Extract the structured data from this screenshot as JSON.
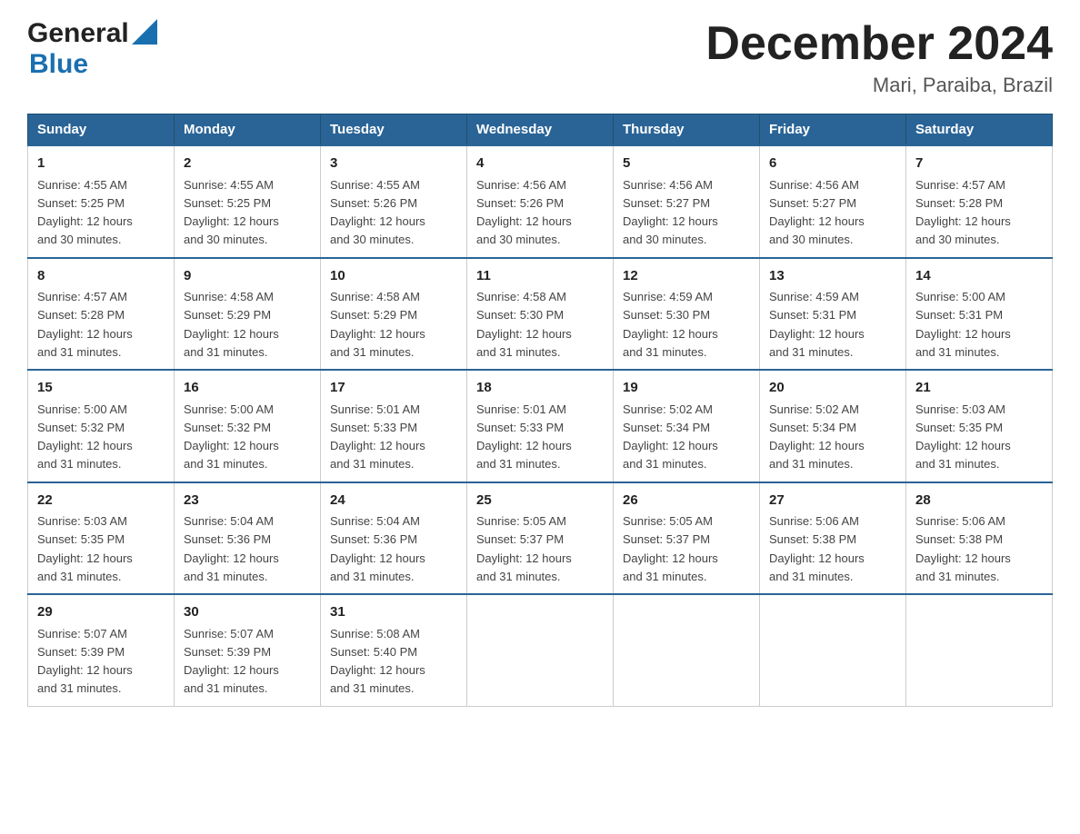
{
  "header": {
    "logo_general": "General",
    "logo_blue": "Blue",
    "title": "December 2024",
    "subtitle": "Mari, Paraiba, Brazil"
  },
  "columns": [
    "Sunday",
    "Monday",
    "Tuesday",
    "Wednesday",
    "Thursday",
    "Friday",
    "Saturday"
  ],
  "weeks": [
    [
      {
        "day": "1",
        "info": "Sunrise: 4:55 AM\nSunset: 5:25 PM\nDaylight: 12 hours\nand 30 minutes."
      },
      {
        "day": "2",
        "info": "Sunrise: 4:55 AM\nSunset: 5:25 PM\nDaylight: 12 hours\nand 30 minutes."
      },
      {
        "day": "3",
        "info": "Sunrise: 4:55 AM\nSunset: 5:26 PM\nDaylight: 12 hours\nand 30 minutes."
      },
      {
        "day": "4",
        "info": "Sunrise: 4:56 AM\nSunset: 5:26 PM\nDaylight: 12 hours\nand 30 minutes."
      },
      {
        "day": "5",
        "info": "Sunrise: 4:56 AM\nSunset: 5:27 PM\nDaylight: 12 hours\nand 30 minutes."
      },
      {
        "day": "6",
        "info": "Sunrise: 4:56 AM\nSunset: 5:27 PM\nDaylight: 12 hours\nand 30 minutes."
      },
      {
        "day": "7",
        "info": "Sunrise: 4:57 AM\nSunset: 5:28 PM\nDaylight: 12 hours\nand 30 minutes."
      }
    ],
    [
      {
        "day": "8",
        "info": "Sunrise: 4:57 AM\nSunset: 5:28 PM\nDaylight: 12 hours\nand 31 minutes."
      },
      {
        "day": "9",
        "info": "Sunrise: 4:58 AM\nSunset: 5:29 PM\nDaylight: 12 hours\nand 31 minutes."
      },
      {
        "day": "10",
        "info": "Sunrise: 4:58 AM\nSunset: 5:29 PM\nDaylight: 12 hours\nand 31 minutes."
      },
      {
        "day": "11",
        "info": "Sunrise: 4:58 AM\nSunset: 5:30 PM\nDaylight: 12 hours\nand 31 minutes."
      },
      {
        "day": "12",
        "info": "Sunrise: 4:59 AM\nSunset: 5:30 PM\nDaylight: 12 hours\nand 31 minutes."
      },
      {
        "day": "13",
        "info": "Sunrise: 4:59 AM\nSunset: 5:31 PM\nDaylight: 12 hours\nand 31 minutes."
      },
      {
        "day": "14",
        "info": "Sunrise: 5:00 AM\nSunset: 5:31 PM\nDaylight: 12 hours\nand 31 minutes."
      }
    ],
    [
      {
        "day": "15",
        "info": "Sunrise: 5:00 AM\nSunset: 5:32 PM\nDaylight: 12 hours\nand 31 minutes."
      },
      {
        "day": "16",
        "info": "Sunrise: 5:00 AM\nSunset: 5:32 PM\nDaylight: 12 hours\nand 31 minutes."
      },
      {
        "day": "17",
        "info": "Sunrise: 5:01 AM\nSunset: 5:33 PM\nDaylight: 12 hours\nand 31 minutes."
      },
      {
        "day": "18",
        "info": "Sunrise: 5:01 AM\nSunset: 5:33 PM\nDaylight: 12 hours\nand 31 minutes."
      },
      {
        "day": "19",
        "info": "Sunrise: 5:02 AM\nSunset: 5:34 PM\nDaylight: 12 hours\nand 31 minutes."
      },
      {
        "day": "20",
        "info": "Sunrise: 5:02 AM\nSunset: 5:34 PM\nDaylight: 12 hours\nand 31 minutes."
      },
      {
        "day": "21",
        "info": "Sunrise: 5:03 AM\nSunset: 5:35 PM\nDaylight: 12 hours\nand 31 minutes."
      }
    ],
    [
      {
        "day": "22",
        "info": "Sunrise: 5:03 AM\nSunset: 5:35 PM\nDaylight: 12 hours\nand 31 minutes."
      },
      {
        "day": "23",
        "info": "Sunrise: 5:04 AM\nSunset: 5:36 PM\nDaylight: 12 hours\nand 31 minutes."
      },
      {
        "day": "24",
        "info": "Sunrise: 5:04 AM\nSunset: 5:36 PM\nDaylight: 12 hours\nand 31 minutes."
      },
      {
        "day": "25",
        "info": "Sunrise: 5:05 AM\nSunset: 5:37 PM\nDaylight: 12 hours\nand 31 minutes."
      },
      {
        "day": "26",
        "info": "Sunrise: 5:05 AM\nSunset: 5:37 PM\nDaylight: 12 hours\nand 31 minutes."
      },
      {
        "day": "27",
        "info": "Sunrise: 5:06 AM\nSunset: 5:38 PM\nDaylight: 12 hours\nand 31 minutes."
      },
      {
        "day": "28",
        "info": "Sunrise: 5:06 AM\nSunset: 5:38 PM\nDaylight: 12 hours\nand 31 minutes."
      }
    ],
    [
      {
        "day": "29",
        "info": "Sunrise: 5:07 AM\nSunset: 5:39 PM\nDaylight: 12 hours\nand 31 minutes."
      },
      {
        "day": "30",
        "info": "Sunrise: 5:07 AM\nSunset: 5:39 PM\nDaylight: 12 hours\nand 31 minutes."
      },
      {
        "day": "31",
        "info": "Sunrise: 5:08 AM\nSunset: 5:40 PM\nDaylight: 12 hours\nand 31 minutes."
      },
      {
        "day": "",
        "info": ""
      },
      {
        "day": "",
        "info": ""
      },
      {
        "day": "",
        "info": ""
      },
      {
        "day": "",
        "info": ""
      }
    ]
  ]
}
